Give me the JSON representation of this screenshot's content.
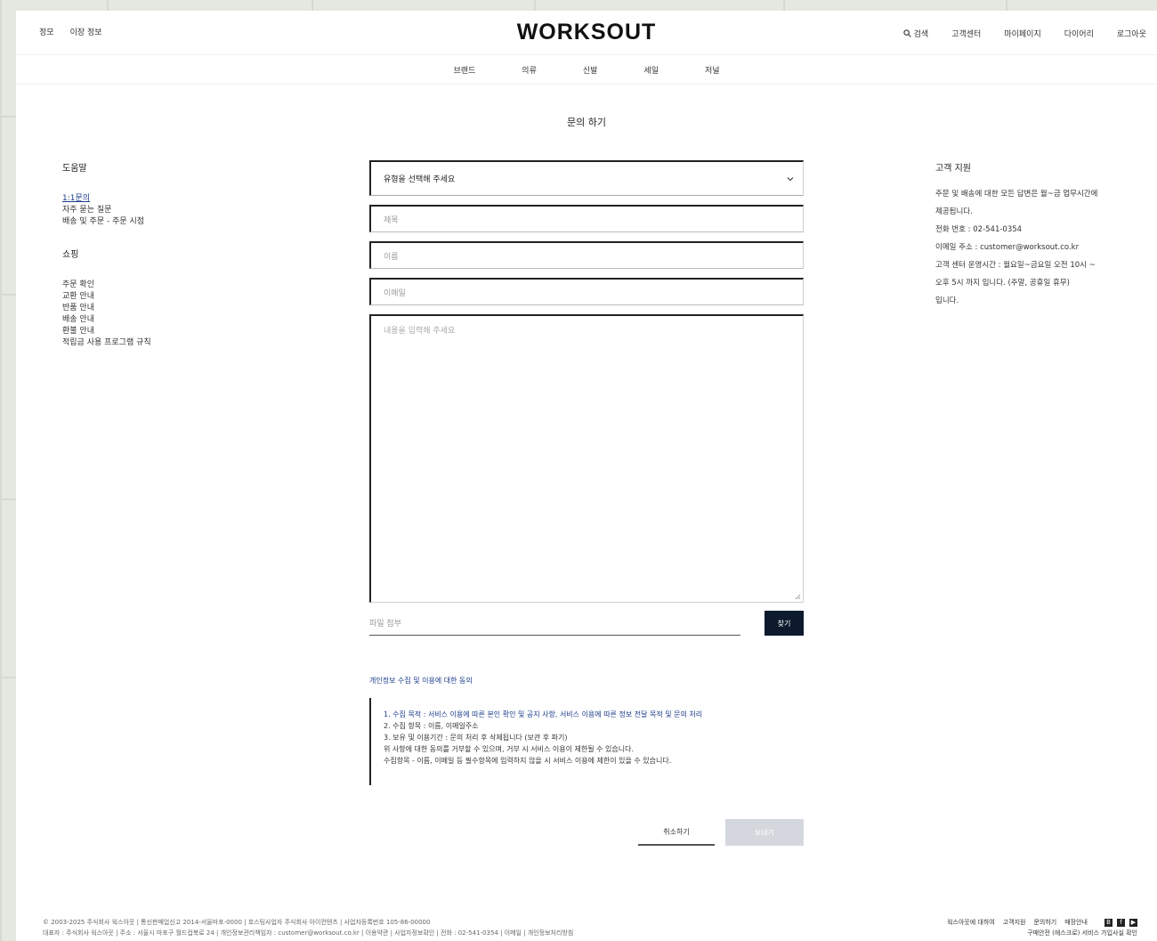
{
  "header": {
    "top_left": [
      "정모",
      "이장 정보"
    ],
    "logo": "WORKSOUT",
    "top_right": {
      "search": "검색",
      "items": [
        "고객센터",
        "마이페이지",
        "다이어리",
        "로그아웃"
      ]
    }
  },
  "nav": [
    "브랜드",
    "의류",
    "신발",
    "세일",
    "저널"
  ],
  "page_title": "문의 하기",
  "sidebar": {
    "section1": "도움말",
    "section1_items": [
      "1:1문의",
      "자주 묻는 질문",
      "배송 및 주문 - 주문 시점"
    ],
    "section2": "쇼핑",
    "section2_items": [
      "주문 확인",
      "교환 안내",
      "반품 안내",
      "배송 안내",
      "환불 안내",
      "적립금 사용 프로그램 규칙"
    ]
  },
  "form": {
    "type_select": "유형을 선택해 주세요",
    "subject_placeholder": "제목",
    "name_placeholder": "이름",
    "email_placeholder": "이메일",
    "content_placeholder": "내용을 입력해 주세요",
    "attach_placeholder": "파일 첨부",
    "attach_button": "찾기",
    "privacy_title": "개인정보 수집 및 이용에 대한 동의",
    "privacy_lines": [
      "1. 수집 목적 : 서비스 이용에 따른 본인 확인 및 공지 사항, 서비스 이용에 따른 정보 전달 목적 및 문의 처리",
      "2. 수집 항목 : 이름, 이메일주소",
      "3. 보유 및 이용기간 : 문의 처리 후 삭제됩니다 (보관 후 파기)",
      "위 사항에 대한 동의를 거부할 수 있으며, 거부 시 서비스 이용이 제한될 수 있습니다.",
      "수집항목 - 이름, 이메일 등 필수항목에 입력하지 않을 시 서비스 이용에 제한이 있을 수 있습니다."
    ],
    "cancel_button": "취소하기",
    "submit_button": "보내기"
  },
  "info": {
    "title": "고객 지원",
    "lines": [
      "주문 및 배송에 대한 모든 답변은 월~금 업무시간에",
      "제공됩니다.",
      "전화 번호 : 02-541-0354",
      "이메일 주소 : customer@worksout.co.kr",
      "고객 센터 운영시간 : 월요일~금요일 오전 10시 ~",
      "오후 5시 까지 입니다. (주말, 공휴일 휴무)",
      "입니다."
    ]
  },
  "footer": {
    "line1": "© 2003-2025 주식회사 웍스아웃 | 통신판매업신고 2014-서울마포-0000 | 호스팅사업자 주식회사 아이컨텐츠 | 사업자등록번호 105-86-00000",
    "line2": "대표자 : 주식회사 웍스아웃 | 주소 : 서울시 마포구 월드컵북로 24 | 개인정보관리책임자 : customer@worksout.co.kr | 이용약관 | 사업자정보확인 | 전화 : 02-541-0354 | 이메일 | 개인정보처리방침",
    "right_links": [
      "웍스아웃에 대하여",
      "고객지원",
      "문의하기",
      "매장안내"
    ],
    "right_line2": "구매안전 (에스크로) 서비스 가입사실 확인"
  }
}
